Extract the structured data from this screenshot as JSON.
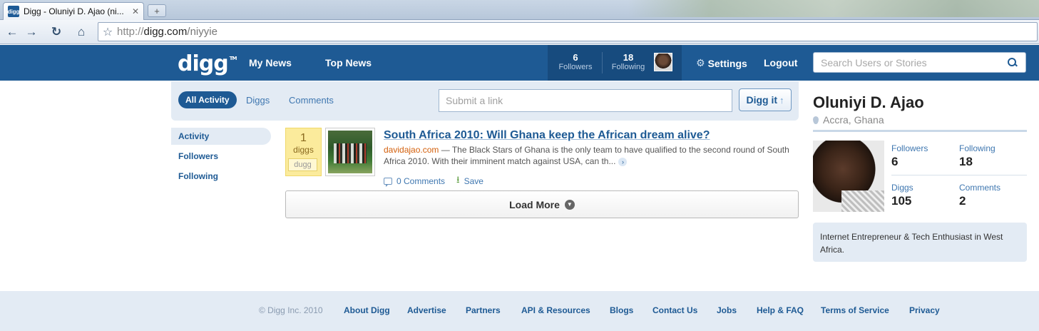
{
  "browser": {
    "tab_title": "Digg - Oluniyi D. Ajao (ni...",
    "tab_favicon": "digg",
    "url_scheme": "http://",
    "url_host": "digg.com",
    "url_path": "/niyyie"
  },
  "header": {
    "logo": "digg",
    "logo_tm": "TM",
    "nav": [
      "My News",
      "Top News"
    ],
    "stats": {
      "followers_count": "6",
      "followers_label": "Followers",
      "following_count": "18",
      "following_label": "Following"
    },
    "settings_label": "Settings",
    "logout_label": "Logout",
    "search_placeholder": "Search Users or Stories"
  },
  "filters": {
    "tabs": [
      "All Activity",
      "Diggs",
      "Comments"
    ],
    "submit_placeholder": "Submit a link",
    "digg_it_label": "Digg it"
  },
  "sidebar": {
    "items": [
      "Activity",
      "Followers",
      "Following"
    ]
  },
  "story": {
    "digg_count": "1",
    "digg_label": "diggs",
    "dugg_label": "dugg",
    "title": "South Africa 2010: Will Ghana keep the African dream alive?",
    "source": "davidajao.com",
    "description": " — The Black Stars of Ghana is the only team to have qualified to the second round of South Africa 2010. With their imminent match against USA, can th...",
    "comments_label": "0 Comments",
    "save_label": "Save"
  },
  "load_more_label": "Load More",
  "profile": {
    "name": "Oluniyi D. Ajao",
    "location": "Accra, Ghana",
    "followers_label": "Followers",
    "followers": "6",
    "following_label": "Following",
    "following": "18",
    "diggs_label": "Diggs",
    "diggs": "105",
    "comments_label": "Comments",
    "comments": "2",
    "bio": "Internet Entrepreneur & Tech Enthusiast in West Africa."
  },
  "footer": {
    "copyright": "© Digg Inc. 2010",
    "links": [
      "About Digg",
      "Advertise",
      "Partners",
      "API & Resources",
      "Blogs",
      "Contact Us",
      "Jobs",
      "Help & FAQ",
      "Terms of Service",
      "Privacy"
    ]
  },
  "colors": {
    "brand_blue": "#1e5a94",
    "digg_yellow": "#fbeb9c",
    "source_orange": "#d35f0b"
  }
}
